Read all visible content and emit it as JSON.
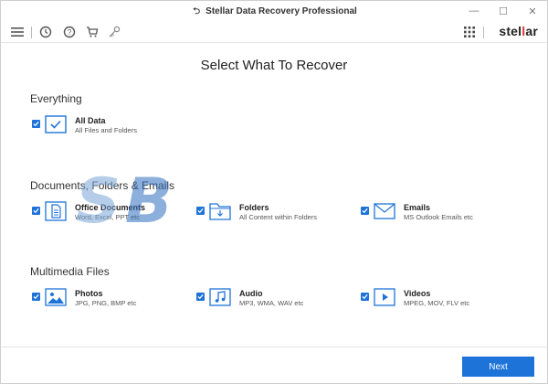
{
  "window": {
    "title": "Stellar Data Recovery Professional",
    "controls": {
      "minimize": "—",
      "maximize": "☐",
      "close": "✕"
    }
  },
  "toolbar": {
    "brand_prefix": "stel",
    "brand_mid": "l",
    "brand_suffix": "ar",
    "icons": [
      "menu-icon",
      "history-icon",
      "help-icon",
      "cart-icon",
      "key-icon",
      "apps-grid-icon"
    ]
  },
  "colors": {
    "accent": "#1e73d8",
    "brand_red": "#e03030"
  },
  "main": {
    "title": "Select What To Recover",
    "sections": [
      {
        "title": "Everything",
        "items": [
          {
            "label": "All Data",
            "sub": "All Files and Folders",
            "icon": "check-box-icon",
            "checked": true
          }
        ]
      },
      {
        "title": "Documents, Folders & Emails",
        "items": [
          {
            "label": "Office Documents",
            "sub": "Word, Excel, PPT etc",
            "icon": "document-icon",
            "checked": true
          },
          {
            "label": "Folders",
            "sub": "All Content within Folders",
            "icon": "folder-icon",
            "checked": true
          },
          {
            "label": "Emails",
            "sub": "MS Outlook Emails etc",
            "icon": "envelope-icon",
            "checked": true
          }
        ]
      },
      {
        "title": "Multimedia Files",
        "items": [
          {
            "label": "Photos",
            "sub": "JPG, PNG, BMP etc",
            "icon": "image-icon",
            "checked": true
          },
          {
            "label": "Audio",
            "sub": "MP3, WMA, WAV etc",
            "icon": "music-note-icon",
            "checked": true
          },
          {
            "label": "Videos",
            "sub": "MPEG, MOV, FLV etc",
            "icon": "video-icon",
            "checked": true
          }
        ]
      }
    ]
  },
  "footer": {
    "next_label": "Next"
  }
}
